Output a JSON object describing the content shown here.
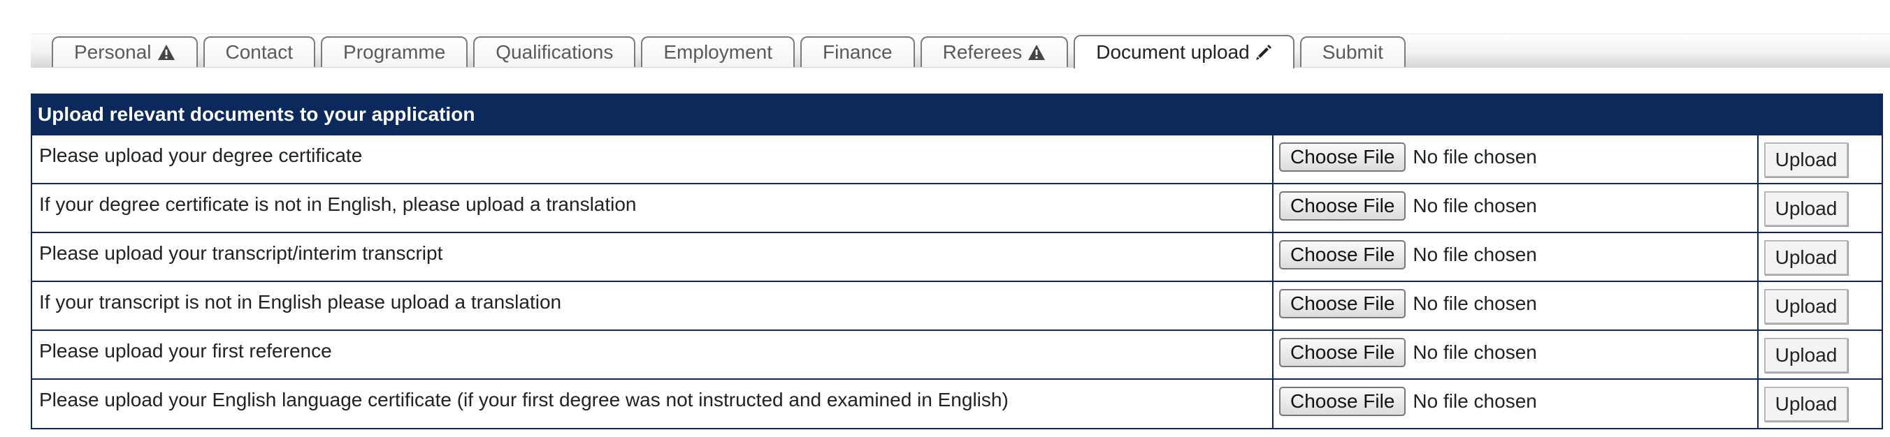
{
  "tabs": [
    {
      "label": "Personal",
      "icon": "warning-icon"
    },
    {
      "label": "Contact"
    },
    {
      "label": "Programme"
    },
    {
      "label": "Qualifications"
    },
    {
      "label": "Employment"
    },
    {
      "label": "Finance"
    },
    {
      "label": "Referees",
      "icon": "warning-icon"
    },
    {
      "label": "Document upload",
      "icon": "pencil-icon",
      "active": true
    },
    {
      "label": "Submit"
    }
  ],
  "panel": {
    "title": "Upload relevant documents to your application"
  },
  "rows": [
    {
      "label": "Please upload your degree certificate",
      "choose_label": "Choose File",
      "file_status": "No file chosen",
      "upload_label": "Upload"
    },
    {
      "label": "If your degree certificate is not in English, please upload a translation",
      "choose_label": "Choose File",
      "file_status": "No file chosen",
      "upload_label": "Upload"
    },
    {
      "label": "Please upload your transcript/interim transcript",
      "choose_label": "Choose File",
      "file_status": "No file chosen",
      "upload_label": "Upload"
    },
    {
      "label": "If your transcript is not in English please upload a translation",
      "choose_label": "Choose File",
      "file_status": "No file chosen",
      "upload_label": "Upload"
    },
    {
      "label": "Please upload your first reference",
      "choose_label": "Choose File",
      "file_status": "No file chosen",
      "upload_label": "Upload"
    },
    {
      "label": "Please upload your English language certificate (if your first degree was not instructed and examined in English)",
      "choose_label": "Choose File",
      "file_status": "No file chosen",
      "upload_label": "Upload"
    }
  ],
  "colors": {
    "header_bg": "#0b2a5b",
    "header_text": "#ffffff",
    "border": "#0b2a5b"
  }
}
